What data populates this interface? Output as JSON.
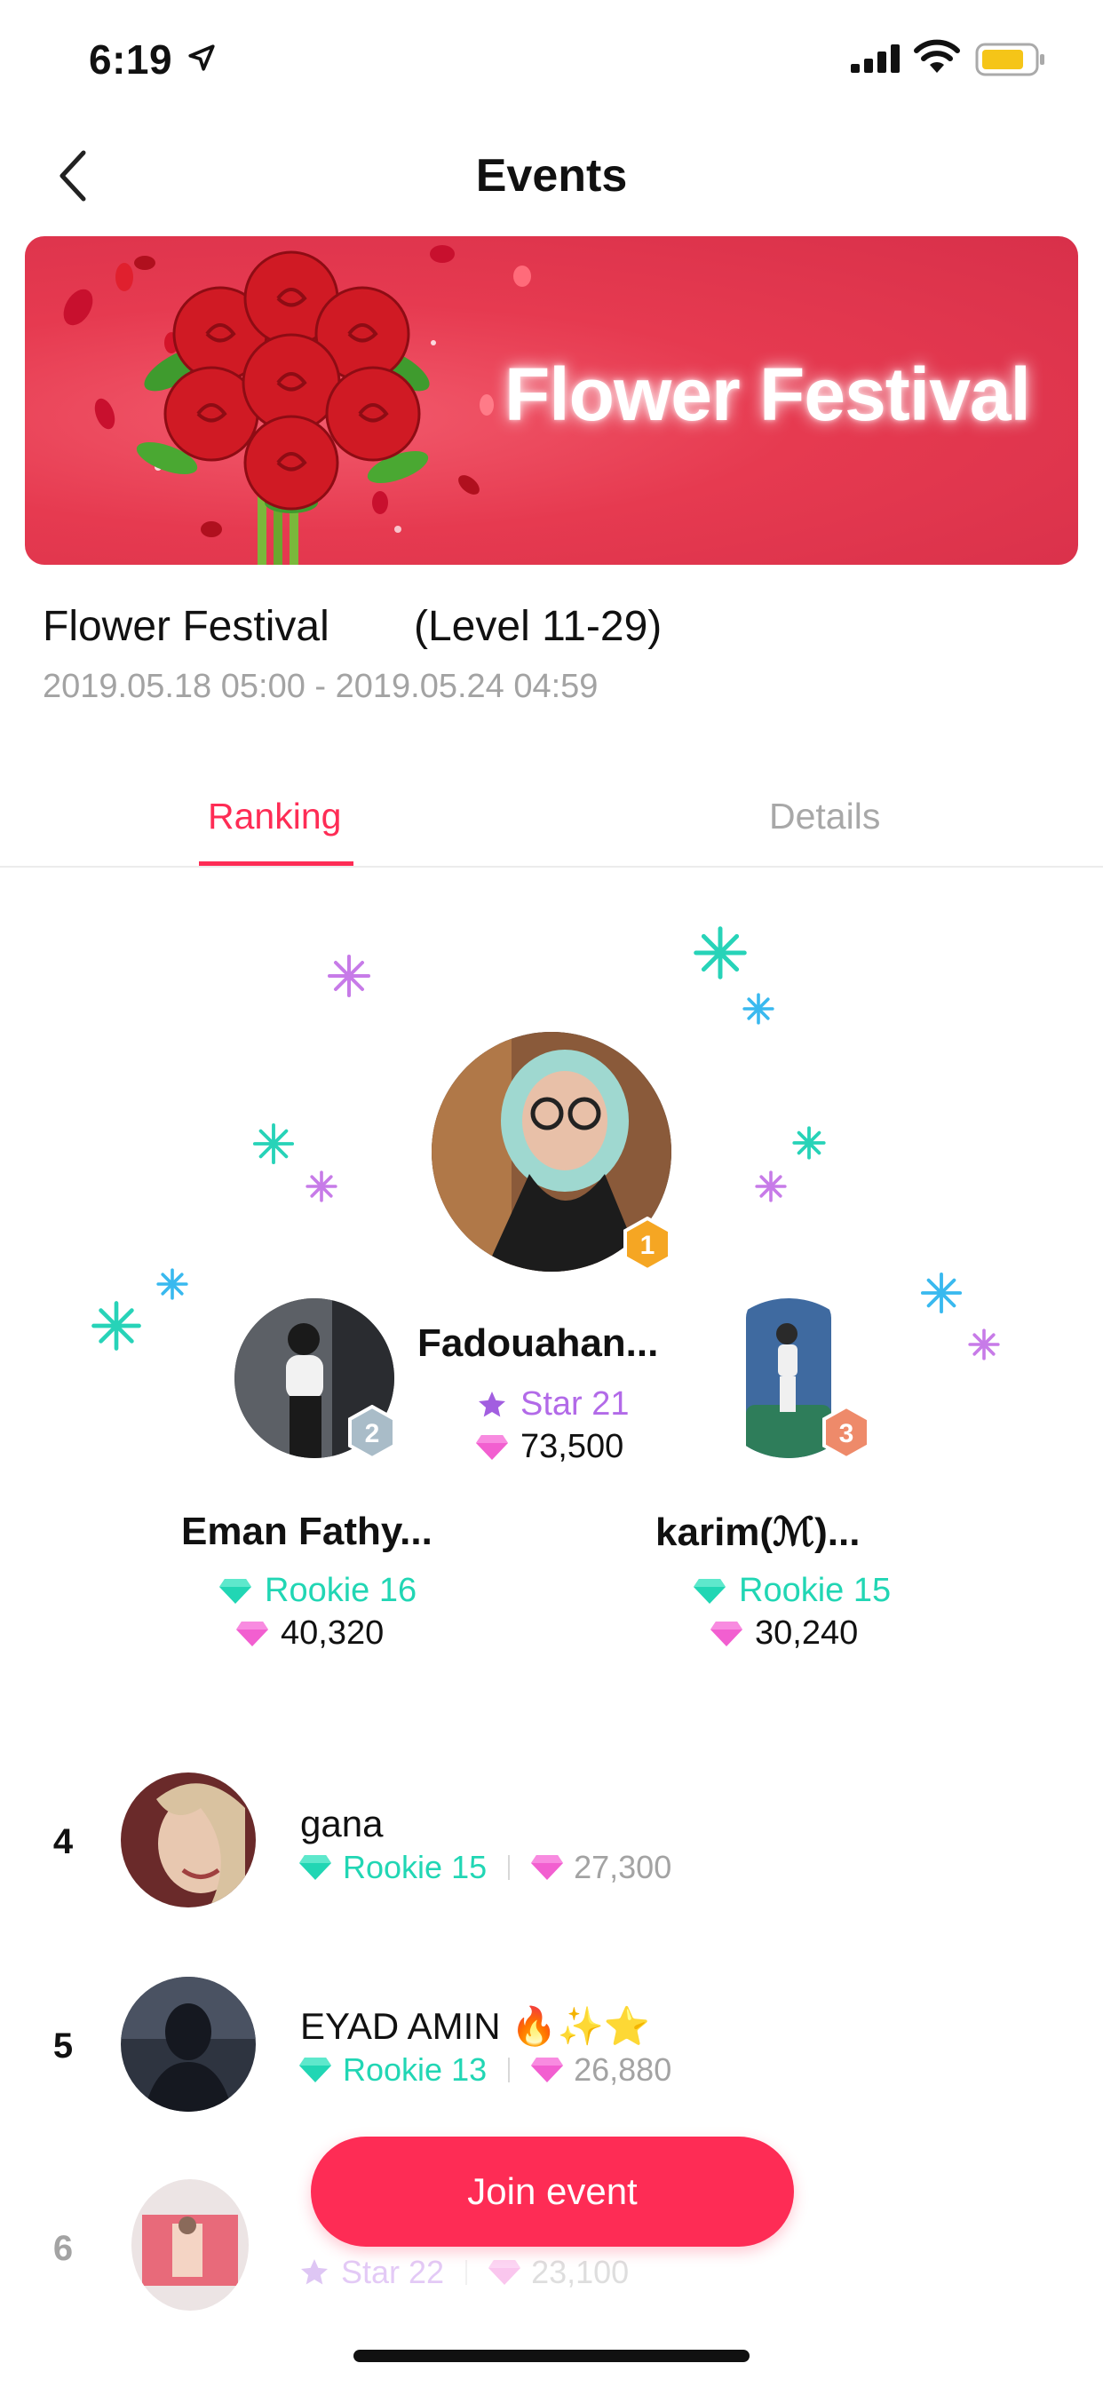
{
  "status_bar": {
    "time": "6:19"
  },
  "nav": {
    "title": "Events"
  },
  "banner": {
    "title": "Flower Festival"
  },
  "event": {
    "name": "Flower Festival",
    "level": "(Level 11-29)",
    "dates": "2019.05.18 05:00 - 2019.05.24 04:59"
  },
  "tabs": {
    "ranking": "Ranking",
    "details": "Details"
  },
  "podium": {
    "first": {
      "rank": "1",
      "name": "Fadouahan...",
      "level": "Star 21",
      "score": "73,500"
    },
    "second": {
      "rank": "2",
      "name": "Eman Fathy...",
      "level": "Rookie 16",
      "score": "40,320"
    },
    "third": {
      "rank": "3",
      "name": "karim(ℳ)...",
      "level": "Rookie 15",
      "score": "30,240"
    }
  },
  "list": [
    {
      "rank": "4",
      "name": "gana",
      "level": "Rookie 15",
      "score": "27,300"
    },
    {
      "rank": "5",
      "name": "EYAD AMIN 🔥✨⭐",
      "level": "Rookie 13",
      "score": "26,880"
    },
    {
      "rank": "6",
      "name": "",
      "level": "Star 22",
      "score": "23,100"
    }
  ],
  "join_button": {
    "label": "Join event"
  },
  "colors": {
    "accent": "#fe2c55",
    "rookie": "#21d6b4",
    "star": "#b26ae8",
    "gem": "#f25fd0"
  }
}
